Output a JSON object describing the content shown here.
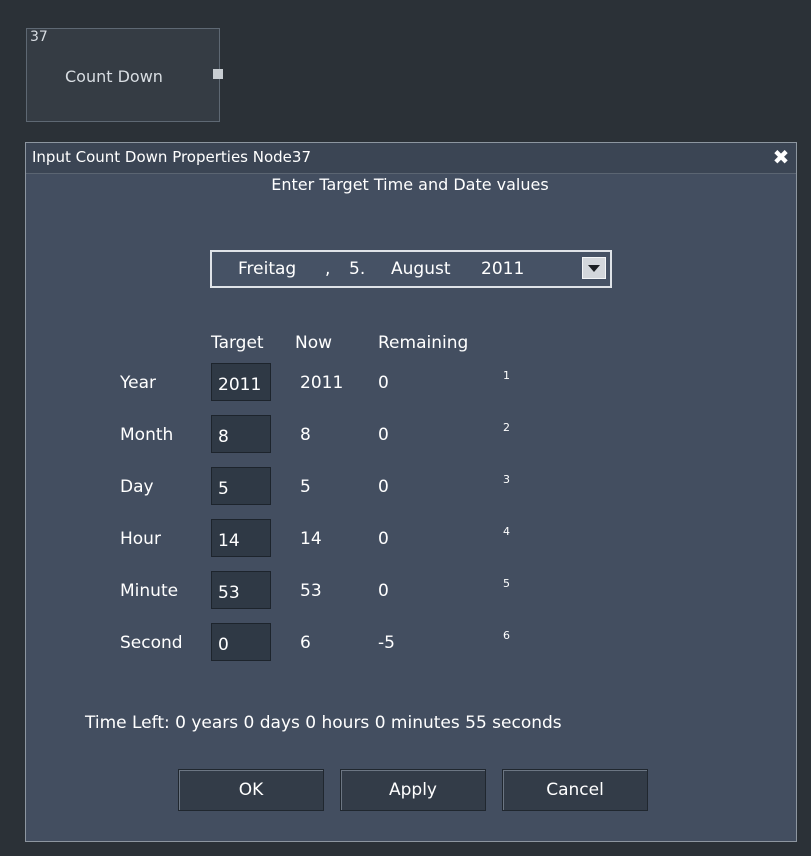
{
  "node": {
    "id": "37",
    "title": "Count Down"
  },
  "dialog": {
    "title": "Input Count Down Properties Node37",
    "close_glyph": "✖",
    "heading": "Enter Target Time and Date values",
    "date_picker": {
      "weekday": "Freitag",
      "separator": ",",
      "day": "5.",
      "month": "August",
      "year": "2011"
    },
    "columns": {
      "target": "Target",
      "now": "Now",
      "remaining": "Remaining"
    },
    "rows": [
      {
        "label": "Year",
        "target": "2011",
        "now": "2011",
        "remaining": "0",
        "index": "1"
      },
      {
        "label": "Month",
        "target": "8",
        "now": "8",
        "remaining": "0",
        "index": "2"
      },
      {
        "label": "Day",
        "target": "5",
        "now": "5",
        "remaining": "0",
        "index": "3"
      },
      {
        "label": "Hour",
        "target": "14",
        "now": "14",
        "remaining": "0",
        "index": "4"
      },
      {
        "label": "Minute",
        "target": "53",
        "now": "53",
        "remaining": "0",
        "index": "5"
      },
      {
        "label": "Second",
        "target": "0",
        "now": "6",
        "remaining": "-5",
        "index": "6"
      }
    ],
    "time_left": "Time Left:  0 years 0 days 0 hours 0 minutes 55 seconds",
    "buttons": {
      "ok": "OK",
      "apply": "Apply",
      "cancel": "Cancel"
    }
  }
}
